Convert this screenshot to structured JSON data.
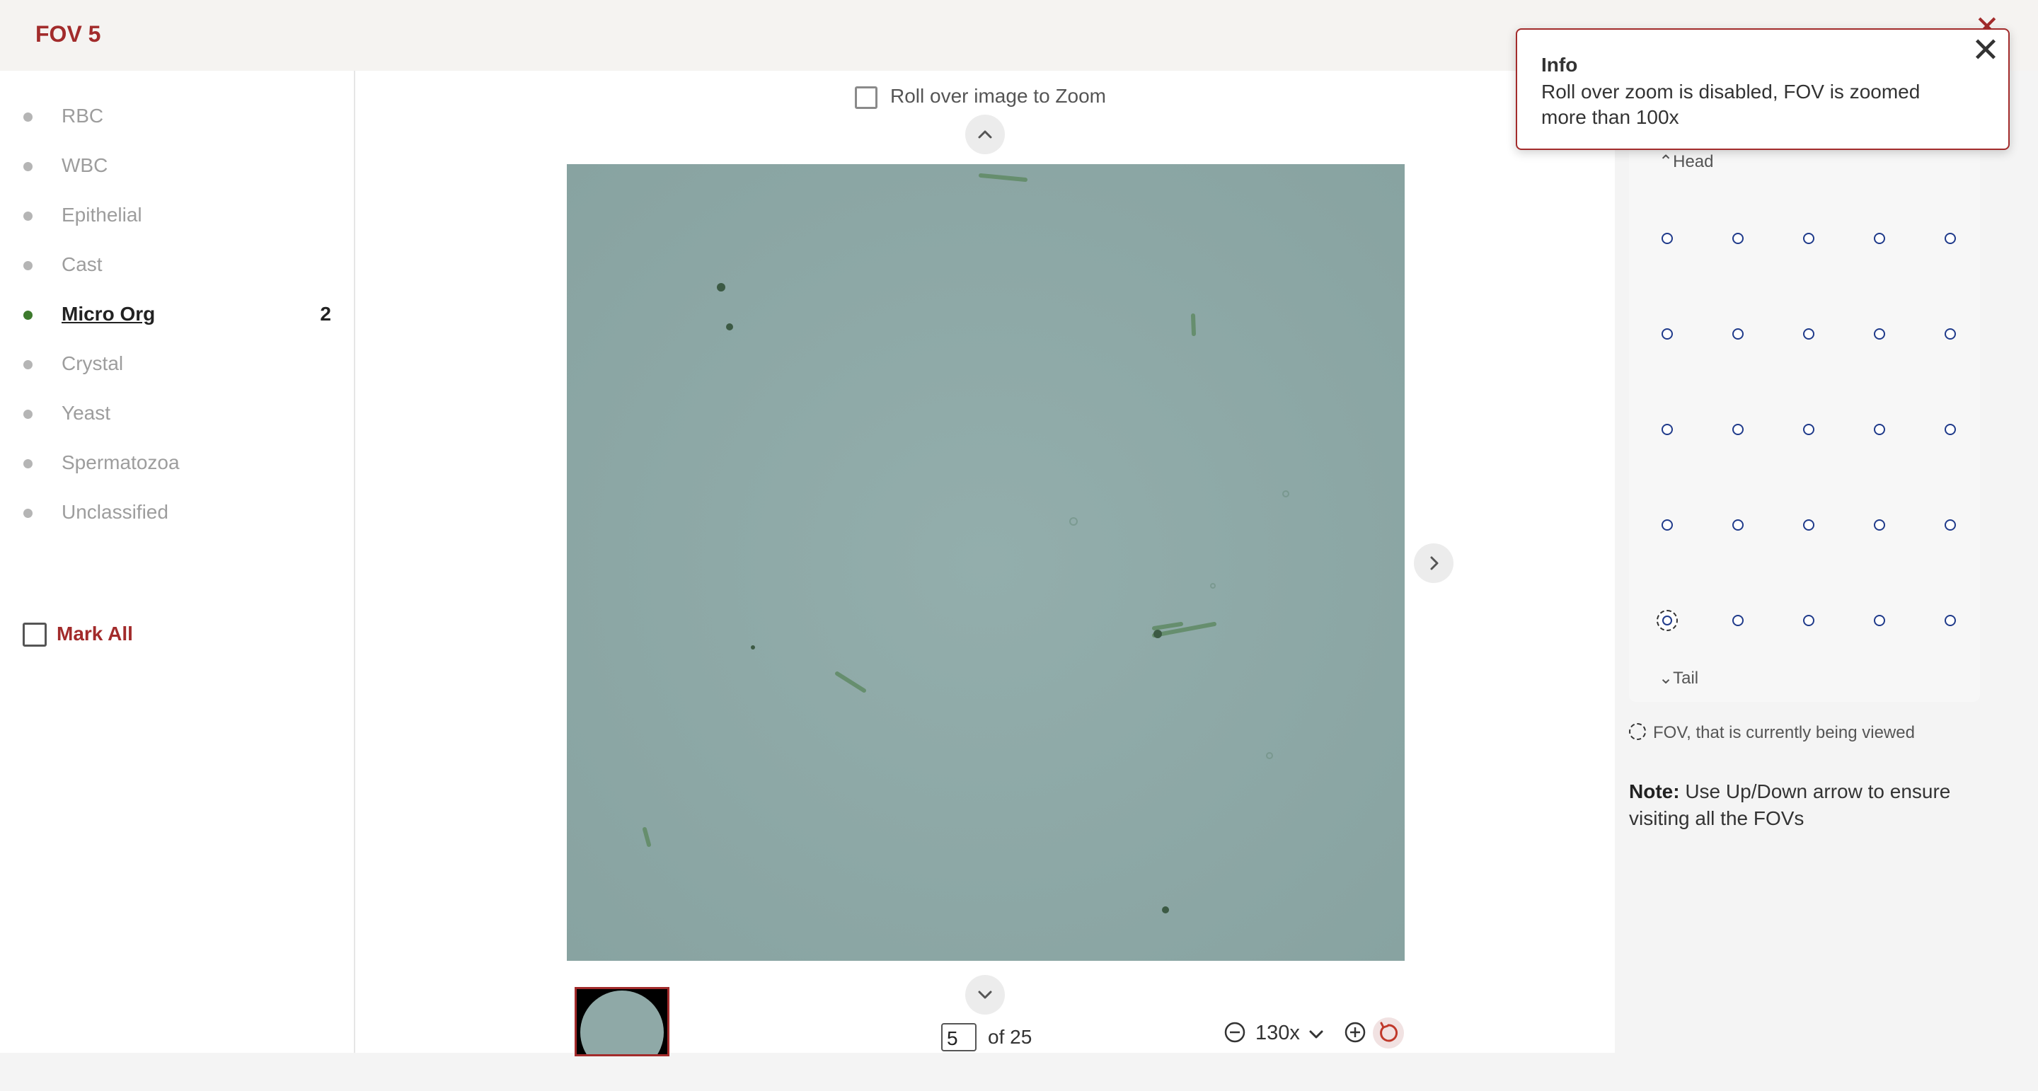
{
  "header": {
    "title": "FOV 5",
    "close_icon": "close-icon"
  },
  "sidebar": {
    "items": [
      {
        "label": "RBC",
        "count": ""
      },
      {
        "label": "WBC",
        "count": ""
      },
      {
        "label": "Epithelial",
        "count": ""
      },
      {
        "label": "Cast",
        "count": ""
      },
      {
        "label": "Micro Org",
        "count": "2",
        "active": true
      },
      {
        "label": "Crystal",
        "count": ""
      },
      {
        "label": "Yeast",
        "count": ""
      },
      {
        "label": "Spermatozoa",
        "count": ""
      },
      {
        "label": "Unclassified",
        "count": ""
      }
    ],
    "mark_all": "Mark All"
  },
  "viewer": {
    "zoom_toggle_label": "Roll over image to Zoom",
    "page_value": "5",
    "page_total": "of 25",
    "zoom_level": "130x"
  },
  "grid": {
    "head_label": "⌃Head",
    "tail_label": "⌄Tail",
    "rows": 5,
    "cols": 5,
    "current_row": 5,
    "current_col": 1
  },
  "legend": {
    "text": "FOV, that is currently being viewed"
  },
  "note": {
    "label": "Note:",
    "text": " Use Up/Down arrow to ensure visiting all the FOVs"
  },
  "toast": {
    "title": "Info",
    "message": "Roll over zoom is disabled, FOV is zoomed more than 100x"
  },
  "colors": {
    "brand": "#a22b2b",
    "active_dot": "#3d7a2d",
    "inactive_dot": "#b5b5b5",
    "grid_dot": "#1f3a8a",
    "image_bg": "#8fa9a7"
  }
}
